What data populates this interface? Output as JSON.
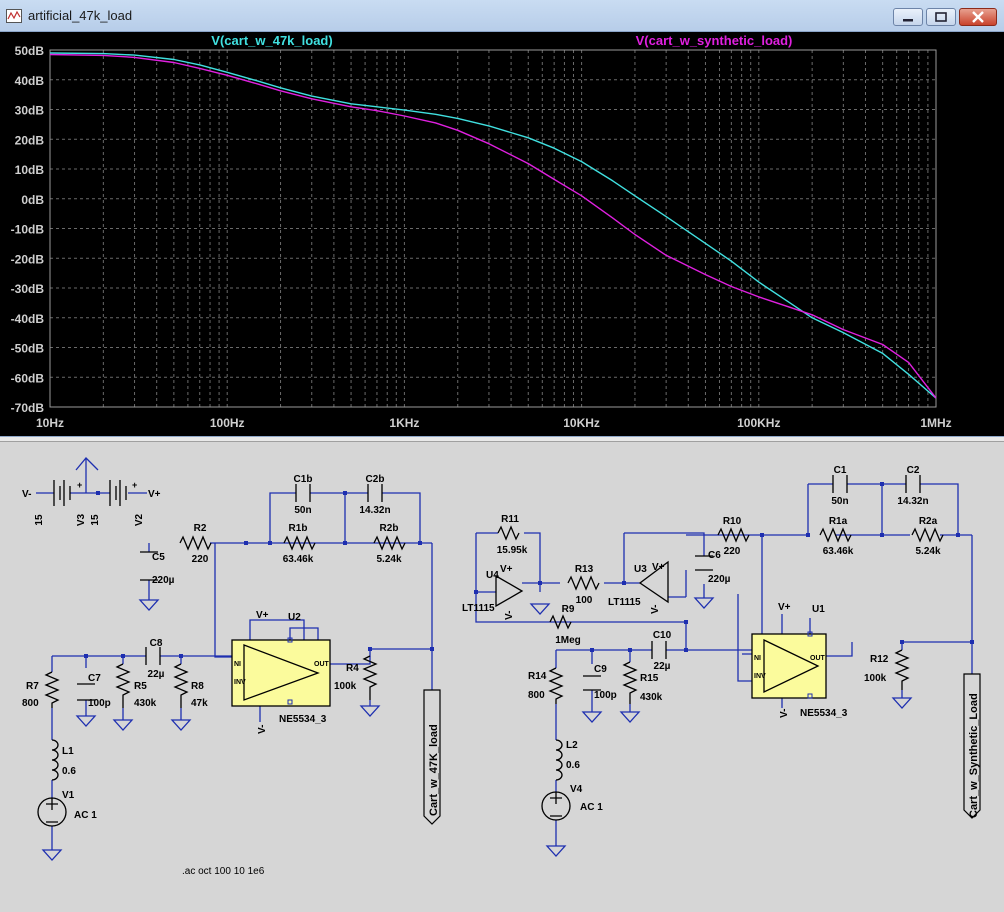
{
  "window": {
    "title": "artificial_47k_load",
    "controls": {
      "minimize": "minimize",
      "restore": "restore",
      "close": "close"
    }
  },
  "colors": {
    "plot_bg": "#000000",
    "axis_text": "#d0d0d0",
    "grid": "#6a6a6a",
    "wire": "#1e2fb0",
    "component": "#000000",
    "opamp_fill": "#fbfb9c",
    "schem_bg": "#d6d6d6"
  },
  "chart_data": {
    "type": "line",
    "x_scale": "log",
    "xlim": [
      10,
      1000000
    ],
    "ylim": [
      -70,
      50
    ],
    "grid": true,
    "x_ticks": [
      {
        "value": 10,
        "label": "10Hz"
      },
      {
        "value": 100,
        "label": "100Hz"
      },
      {
        "value": 1000,
        "label": "1KHz"
      },
      {
        "value": 10000,
        "label": "10KHz"
      },
      {
        "value": 100000,
        "label": "100KHz"
      },
      {
        "value": 1000000,
        "label": "1MHz"
      }
    ],
    "y_ticks": [
      {
        "value": 50,
        "label": "50dB"
      },
      {
        "value": 40,
        "label": "40dB"
      },
      {
        "value": 30,
        "label": "30dB"
      },
      {
        "value": 20,
        "label": "20dB"
      },
      {
        "value": 10,
        "label": "10dB"
      },
      {
        "value": 0,
        "label": "0dB"
      },
      {
        "value": -10,
        "label": "-10dB"
      },
      {
        "value": -20,
        "label": "-20dB"
      },
      {
        "value": -30,
        "label": "-30dB"
      },
      {
        "value": -40,
        "label": "-40dB"
      },
      {
        "value": -50,
        "label": "-50dB"
      },
      {
        "value": -60,
        "label": "-60dB"
      },
      {
        "value": -70,
        "label": "-70dB"
      }
    ],
    "series": [
      {
        "name": "V(cart_w_47k_load)",
        "color": "#40e0e0",
        "x": [
          10,
          20,
          30,
          50,
          70,
          100,
          150,
          200,
          300,
          500,
          700,
          1000,
          1500,
          2000,
          3000,
          5000,
          7000,
          10000,
          15000,
          20000,
          30000,
          50000,
          70000,
          100000,
          150000,
          200000,
          300000,
          500000,
          700000,
          1000000
        ],
        "y": [
          49,
          48.8,
          48.3,
          46.8,
          45,
          42.5,
          39.5,
          37.3,
          34.5,
          31.9,
          30.9,
          29.8,
          28.4,
          27,
          24.5,
          20.5,
          17,
          12.5,
          6,
          1,
          -6,
          -15,
          -21,
          -28,
          -35,
          -40,
          -45,
          -52,
          -59,
          -67
        ]
      },
      {
        "name": "V(cart_w_synthetic_load)",
        "color": "#e020e0",
        "x": [
          10,
          20,
          30,
          50,
          70,
          100,
          150,
          200,
          300,
          500,
          700,
          1000,
          1500,
          2000,
          3000,
          5000,
          7000,
          10000,
          15000,
          20000,
          30000,
          50000,
          70000,
          100000,
          150000,
          200000,
          300000,
          500000,
          700000,
          1000000
        ],
        "y": [
          48.5,
          48.2,
          47.5,
          45.8,
          43.8,
          41.5,
          38.5,
          36.3,
          33.6,
          30.9,
          29.6,
          27.8,
          25.5,
          23,
          18.5,
          11.8,
          6.5,
          1,
          -6.5,
          -12,
          -19,
          -25.5,
          -29.5,
          -33,
          -36.5,
          -39,
          -44,
          -49,
          -55,
          -67
        ]
      }
    ]
  },
  "schematic": {
    "left": {
      "supply": {
        "v3_name": "V3",
        "v3_value": "15",
        "v2_name": "V2",
        "v2_value": "15",
        "vminus": "V-",
        "vplus": "V+",
        "plus": "+"
      },
      "c5": {
        "name": "C5",
        "value": "220µ"
      },
      "r2": {
        "name": "R2",
        "value": "220"
      },
      "c1b": {
        "name": "C1b",
        "value": "50n"
      },
      "c2b": {
        "name": "C2b",
        "value": "14.32n"
      },
      "r1b": {
        "name": "R1b",
        "value": "63.46k"
      },
      "r2b": {
        "name": "R2b",
        "value": "5.24k"
      },
      "c8": {
        "name": "C8",
        "value": "22µ"
      },
      "r7": {
        "name": "R7",
        "value": "800"
      },
      "c7": {
        "name": "C7",
        "value": "100p"
      },
      "r5": {
        "name": "R5",
        "value": "430k"
      },
      "r8": {
        "name": "R8",
        "value": "47k"
      },
      "r4": {
        "name": "R4",
        "value": "100k"
      },
      "u2": {
        "name": "U2",
        "part": "NE5534_3",
        "ni": "NI",
        "inv": "INV",
        "out": "OUT",
        "vp": "V+",
        "vm": "V-"
      },
      "l1": {
        "name": "L1",
        "value": "0.6"
      },
      "v1": {
        "name": "V1",
        "value": "AC 1"
      },
      "net": "Cart_w_47K_load",
      "directive": ".ac oct 100 10 1e6"
    },
    "right": {
      "r11": {
        "name": "R11",
        "value": "15.95k"
      },
      "u4": {
        "name": "U4",
        "part": "LT1115",
        "vp": "V+",
        "vm": "V-"
      },
      "r13": {
        "name": "R13",
        "value": "100"
      },
      "u3": {
        "name": "U3",
        "part": "LT1115",
        "vp": "V+",
        "vm": "V-"
      },
      "r9": {
        "name": "R9",
        "value": "1Meg"
      },
      "c6": {
        "name": "C6",
        "value": "220µ"
      },
      "r10": {
        "name": "R10",
        "value": "220"
      },
      "c1": {
        "name": "C1",
        "value": "50n"
      },
      "c2": {
        "name": "C2",
        "value": "14.32n"
      },
      "r1a": {
        "name": "R1a",
        "value": "63.46k"
      },
      "r2a": {
        "name": "R2a",
        "value": "5.24k"
      },
      "c10": {
        "name": "C10",
        "value": "22µ"
      },
      "r14": {
        "name": "R14",
        "value": "800"
      },
      "c9": {
        "name": "C9",
        "value": "100p"
      },
      "r15": {
        "name": "R15",
        "value": "430k"
      },
      "r12": {
        "name": "R12",
        "value": "100k"
      },
      "u1": {
        "name": "U1",
        "part": "NE5534_3",
        "ni": "NI",
        "inv": "INV",
        "out": "OUT",
        "vp": "V+",
        "vm": "V-"
      },
      "l2": {
        "name": "L2",
        "value": "0.6"
      },
      "v4": {
        "name": "V4",
        "value": "AC 1"
      },
      "net": "Cart_w_Synthetic_Load"
    }
  }
}
